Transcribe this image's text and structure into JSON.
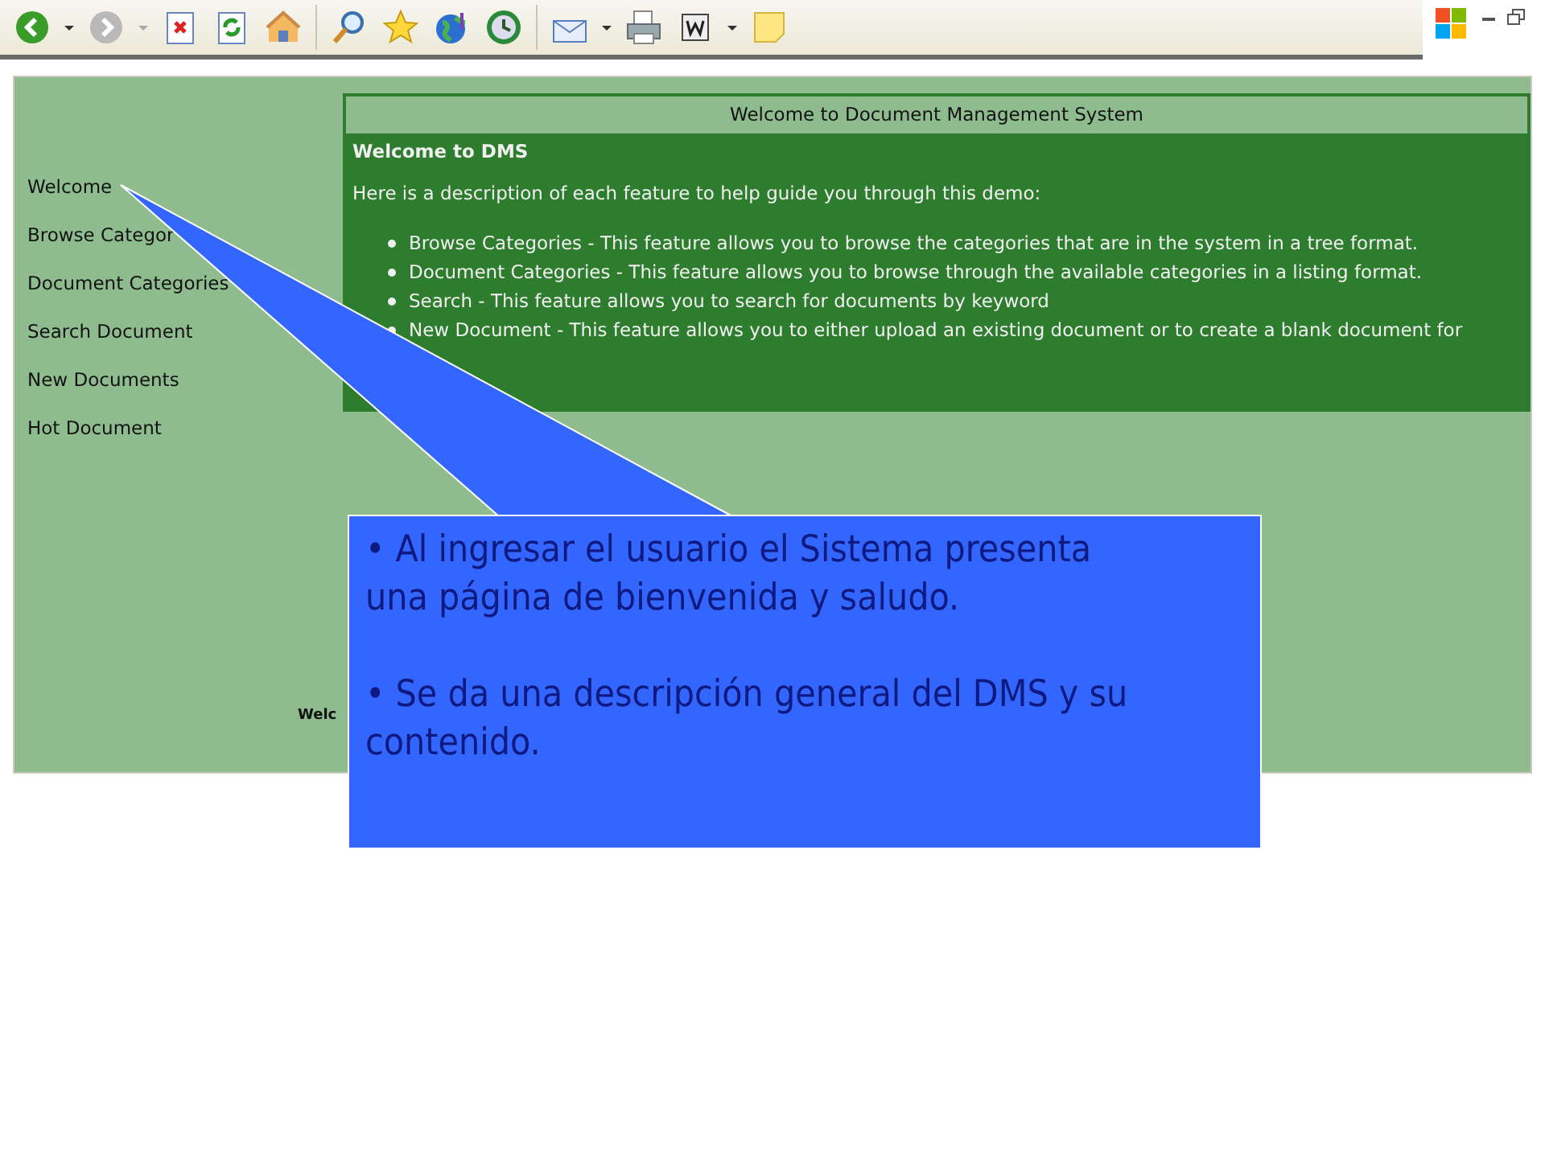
{
  "sidebar": {
    "items": [
      {
        "label": "Welcome"
      },
      {
        "label": "Browse Categor"
      },
      {
        "label": "Document Categories"
      },
      {
        "label": "Search Document"
      },
      {
        "label": "New Documents"
      },
      {
        "label": "Hot Document"
      }
    ]
  },
  "panel": {
    "title": "Welcome to Document Management System",
    "heading": "Welcome to DMS",
    "intro": "Here is a description of each feature to help guide you through this demo:",
    "features": [
      "Browse Categories - This feature allows you to browse the categories that are in the system in a tree format.",
      "Document Categories - This feature allows you to browse through the available categories in a listing format.",
      "Search - This feature allows you to search for documents by keyword",
      "New Document - This feature allows you to either upload an existing document or to create a blank document for"
    ]
  },
  "footer_text": "Welc",
  "callout": {
    "points": [
      "• Al ingresar el usuario el Sistema presenta una página de bienvenida y saludo.",
      "• Se da una descripción general del DMS y su contenido."
    ]
  }
}
